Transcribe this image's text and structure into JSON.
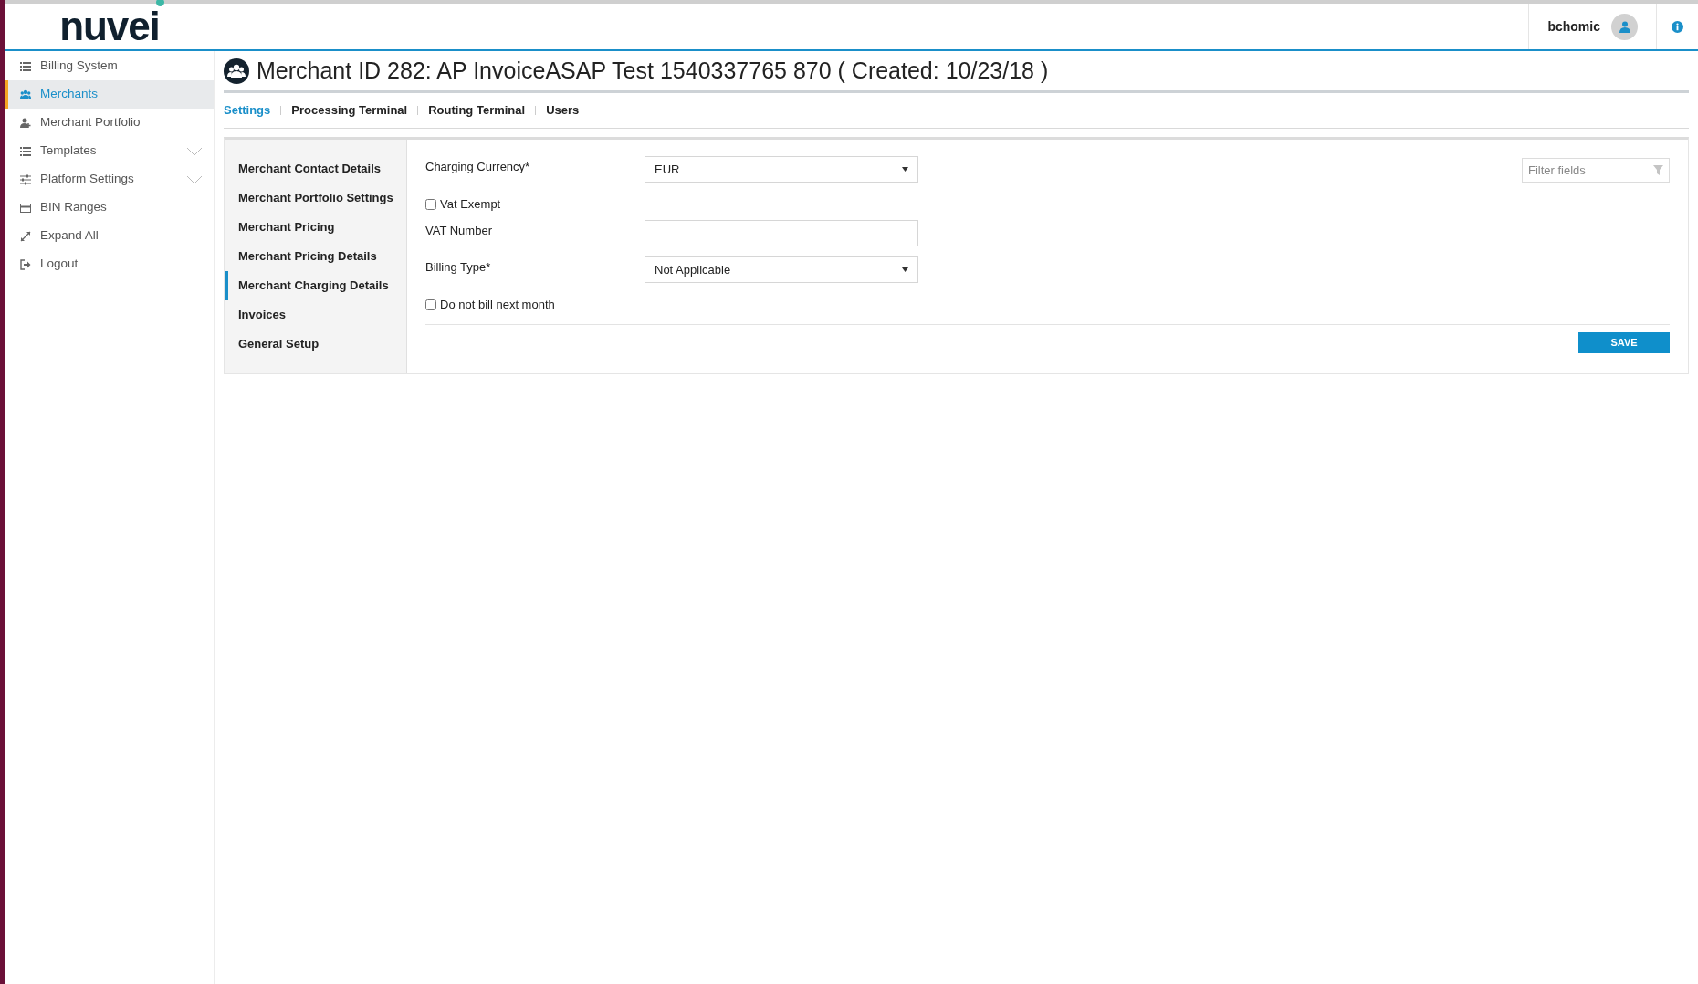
{
  "header": {
    "logo": "nuvei",
    "user": "bchomic"
  },
  "sidebar": {
    "items": [
      {
        "label": "Billing System",
        "kind": "list",
        "selected": false
      },
      {
        "label": "Merchants",
        "kind": "users",
        "selected": true
      },
      {
        "label": "Merchant Portfolio",
        "kind": "user-plus",
        "selected": false
      },
      {
        "label": "Templates",
        "kind": "list",
        "selected": false,
        "expanded": false
      },
      {
        "label": "Platform Settings",
        "kind": "sliders",
        "selected": false,
        "expanded": false
      },
      {
        "label": "BIN Ranges",
        "kind": "card",
        "selected": false
      },
      {
        "label": "Expand All",
        "kind": "expand",
        "selected": false
      },
      {
        "label": "Logout",
        "kind": "logout",
        "selected": false
      }
    ]
  },
  "page": {
    "title": "Merchant ID 282: AP InvoiceASAP Test 1540337765 870 ( Created: 10/23/18 )",
    "tabs": [
      {
        "label": "Settings",
        "selected": true
      },
      {
        "label": "Processing Terminal",
        "selected": false
      },
      {
        "label": "Routing Terminal",
        "selected": false
      },
      {
        "label": "Users",
        "selected": false
      }
    ],
    "sections": [
      {
        "label": "Merchant Contact Details",
        "selected": false
      },
      {
        "label": "Merchant Portfolio Settings",
        "selected": false
      },
      {
        "label": "Merchant Pricing",
        "selected": false
      },
      {
        "label": "Merchant Pricing Details",
        "selected": false
      },
      {
        "label": "Merchant Charging Details",
        "selected": true
      },
      {
        "label": "Invoices",
        "selected": false
      },
      {
        "label": "General Setup",
        "selected": false
      }
    ],
    "fields": [
      {
        "kind": "select",
        "label": "Charging Currency*",
        "value": "EUR"
      },
      {
        "kind": "checkbox",
        "label": "Vat Exempt",
        "checked": false
      },
      {
        "kind": "text",
        "label": "VAT Number"
      },
      {
        "kind": "select",
        "label": "Billing Type*",
        "value": "Not Applicable"
      },
      {
        "kind": "checkbox",
        "label": "Do not bill next month",
        "checked": false
      }
    ],
    "filter": {
      "placeholder": "Filter fields"
    },
    "save_button": "SAVE"
  }
}
